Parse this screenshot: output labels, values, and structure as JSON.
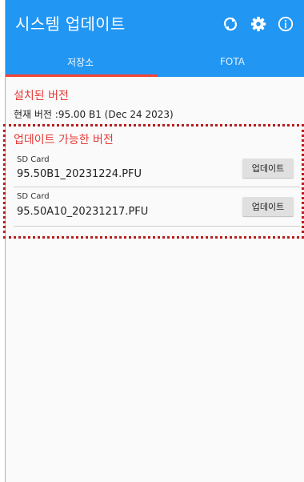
{
  "app": {
    "title": "시스템 업데이트",
    "colors": {
      "appbar": "#2196f3",
      "accent": "#f44336",
      "section_title": "#e53935",
      "highlight": "#b71c1c"
    }
  },
  "toolbar": {
    "icons": [
      "refresh-icon",
      "gear-icon",
      "info-icon"
    ]
  },
  "tabs": [
    {
      "label": "저장소",
      "selected": true
    },
    {
      "label": "FOTA",
      "selected": false
    }
  ],
  "installed": {
    "title": "설치된 버전",
    "value": "현재 버전 :95.00 B1 (Dec 24 2023)"
  },
  "available": {
    "title": "업데이트 가능한 버전",
    "items": [
      {
        "source": "SD Card",
        "file": "95.50B1_20231224.PFU",
        "button": "업데이트"
      },
      {
        "source": "SD Card",
        "file": "95.50A10_20231217.PFU",
        "button": "업데이트"
      }
    ]
  }
}
